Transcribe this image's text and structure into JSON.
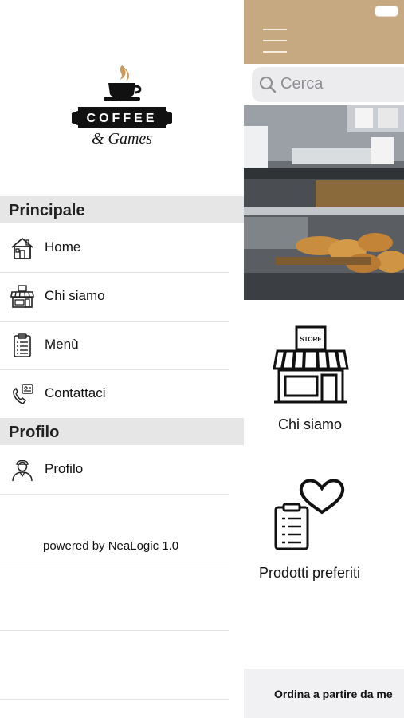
{
  "main": {
    "search": {
      "placeholder": "Cerca"
    },
    "tiles": [
      {
        "label": "Chi siamo",
        "icon": "store-icon"
      },
      {
        "label": "Prodotti preferiti",
        "icon": "clipboard-heart-icon"
      }
    ],
    "footer": {
      "text": "Ordina a partire da me"
    }
  },
  "drawer": {
    "logo": {
      "word1": "COFFEE",
      "word2": "& Games"
    },
    "sections": [
      {
        "title": "Principale",
        "items": [
          {
            "label": "Home",
            "icon": "house-icon"
          },
          {
            "label": "Chi siamo",
            "icon": "store-icon"
          },
          {
            "label": "Menù",
            "icon": "clipboard-icon"
          },
          {
            "label": "Contattaci",
            "icon": "phone-contact-icon"
          }
        ]
      },
      {
        "title": "Profilo",
        "items": [
          {
            "label": "Profilo",
            "icon": "user-icon"
          }
        ]
      }
    ],
    "powered_by": "powered by NeaLogic 1.0"
  },
  "colors": {
    "topbar": "#c6a980",
    "section_header": "#e6e6e6",
    "search_bg": "#ececee"
  }
}
